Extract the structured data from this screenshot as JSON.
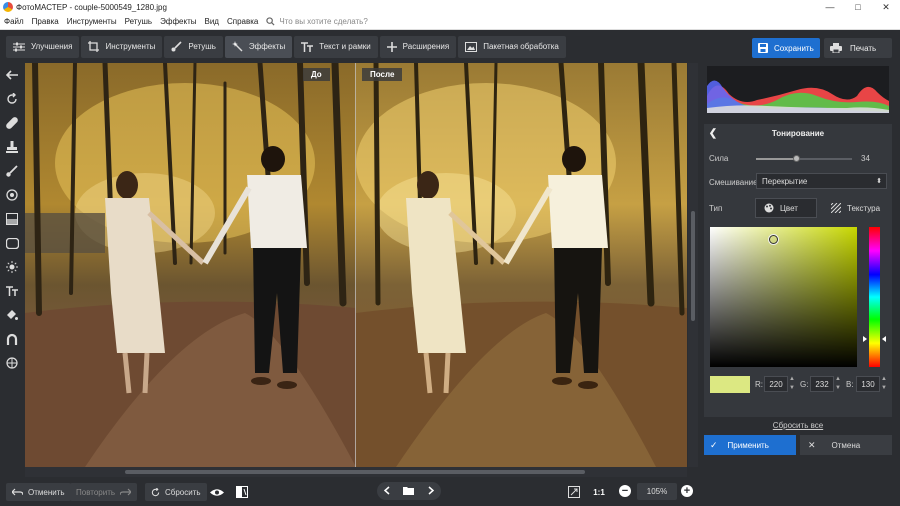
{
  "window": {
    "title": "ФотоМАСТЕР - couple-5000549_1280.jpg",
    "minimize": "—",
    "maximize": "□",
    "close": "✕"
  },
  "menu": {
    "items": [
      "Файл",
      "Правка",
      "Инструменты",
      "Ретушь",
      "Эффекты",
      "Вид",
      "Справка"
    ],
    "search_placeholder": "Что вы хотите сделать?"
  },
  "toolbar": {
    "tabs": [
      {
        "label": "Улучшения",
        "icon": "sliders-icon"
      },
      {
        "label": "Инструменты",
        "icon": "crop-icon"
      },
      {
        "label": "Ретушь",
        "icon": "brush-icon"
      },
      {
        "label": "Эффекты",
        "icon": "magic-wand-icon"
      },
      {
        "label": "Текст и рамки",
        "icon": "text-icon"
      },
      {
        "label": "Расширения",
        "icon": "plus-icon"
      },
      {
        "label": "Пакетная обработка",
        "icon": "batch-icon"
      }
    ],
    "active_tab": "Эффекты",
    "save_label": "Сохранить",
    "print_label": "Печать"
  },
  "left_tools": [
    "back-arrow-icon",
    "rotate-icon",
    "bandage-icon",
    "stamp-icon",
    "brush-icon",
    "radial-filter-icon",
    "gradient-filter-icon",
    "vignette-icon",
    "light-icon",
    "text-icon",
    "fill-icon",
    "magnet-icon",
    "globe-icon"
  ],
  "canvas": {
    "before_label": "До",
    "after_label": "После"
  },
  "bottom": {
    "undo_label": "Отменить",
    "redo_label": "Повторить",
    "reset_label": "Сбросить",
    "fit_label": "1:1",
    "zoom": "105%"
  },
  "panel": {
    "title": "Тонирование",
    "strength_label": "Сила",
    "strength_value": "34",
    "blend_label": "Смешивание",
    "blend_value": "Перекрытие",
    "type_label": "Тип",
    "type_color": "Цвет",
    "type_texture": "Текстура",
    "r_label": "R:",
    "g_label": "G:",
    "b_label": "B:",
    "r_value": "220",
    "g_value": "232",
    "b_value": "130",
    "swatch_color": "#dce882",
    "reset_all": "Сбросить все",
    "apply_label": "Применить",
    "cancel_label": "Отмена"
  },
  "colors": {
    "accent": "#1e6fd0",
    "background": "#2b2d31"
  }
}
